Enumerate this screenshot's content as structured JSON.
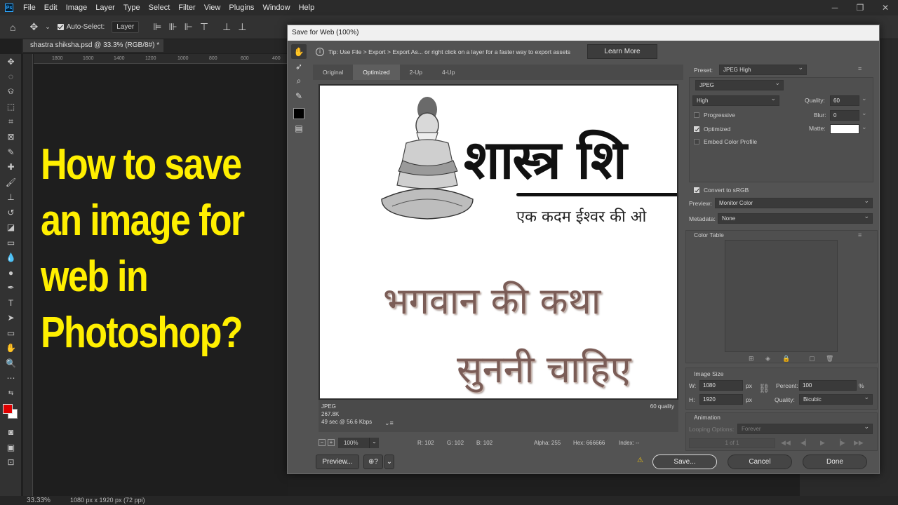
{
  "app": {
    "menu": [
      "File",
      "Edit",
      "Image",
      "Layer",
      "Type",
      "Select",
      "Filter",
      "View",
      "Plugins",
      "Window",
      "Help"
    ],
    "window_controls": [
      "─",
      "❐",
      "✕"
    ],
    "logo": "Ps"
  },
  "options_bar": {
    "auto_select_label": "Auto-Select:",
    "auto_select_value": "Layer"
  },
  "document": {
    "tab_label": "shastra shiksha.psd @ 33.3% (RGB/8#) *",
    "ruler_ticks": [
      "1800",
      "1600",
      "1400",
      "1200",
      "1000",
      "800",
      "600",
      "400"
    ],
    "headline_lines": [
      "How to save",
      "an image for",
      "web in",
      "Photoshop?"
    ],
    "headline_color": "#ffef00"
  },
  "status_bar": {
    "zoom": "33.33%",
    "doc_info": "1080 px x 1920 px (72 ppi)"
  },
  "dialog": {
    "title": "Save for Web (100%)",
    "tip": "Tip: Use File > Export > Export As...  or right click on a layer for a faster way to export assets",
    "learn_more": "Learn More",
    "tabs": [
      "Original",
      "Optimized",
      "2-Up",
      "4-Up"
    ],
    "active_tab": "Optimized",
    "preview": {
      "title_text": "शास्त्र शि",
      "subtitle_text": "एक कदम ईश्वर की ओ",
      "line1": "भगवान की कथा",
      "line2": "सुननी चाहिए"
    },
    "preview_info": {
      "format": "JPEG",
      "size": "267.8K",
      "time": "49 sec @ 56.6 Kbps",
      "quality": "60 quality"
    },
    "zoom_bar": {
      "zoom": "100%",
      "r": "R: 102",
      "g": "G: 102",
      "b": "B: 102",
      "alpha": "Alpha: 255",
      "hex": "Hex: 666666",
      "index": "Index: --"
    },
    "buttons": {
      "preview": "Preview...",
      "save": "Save...",
      "cancel": "Cancel",
      "done": "Done"
    },
    "settings": {
      "preset_label": "Preset:",
      "preset_value": "JPEG High",
      "format_value": "JPEG",
      "compression_value": "High",
      "quality_label": "Quality:",
      "quality_value": "60",
      "progressive_label": "Progressive",
      "blur_label": "Blur:",
      "blur_value": "0",
      "optimized_label": "Optimized",
      "matte_label": "Matte:",
      "embed_label": "Embed Color Profile",
      "convert_label": "Convert to sRGB",
      "preview_label": "Preview:",
      "preview_value": "Monitor Color",
      "metadata_label": "Metadata:",
      "metadata_value": "None",
      "color_table_label": "Color Table",
      "image_size_label": "Image Size",
      "w_label": "W:",
      "w_value": "1080",
      "h_label": "H:",
      "h_value": "1920",
      "px": "px",
      "percent_label": "Percent:",
      "percent_value": "100",
      "percent_unit": "%",
      "quality2_label": "Quality:",
      "quality2_value": "Bicubic",
      "animation_label": "Animation",
      "looping_label": "Looping Options:",
      "looping_value": "Forever",
      "frame_counter": "1 of 1"
    }
  }
}
